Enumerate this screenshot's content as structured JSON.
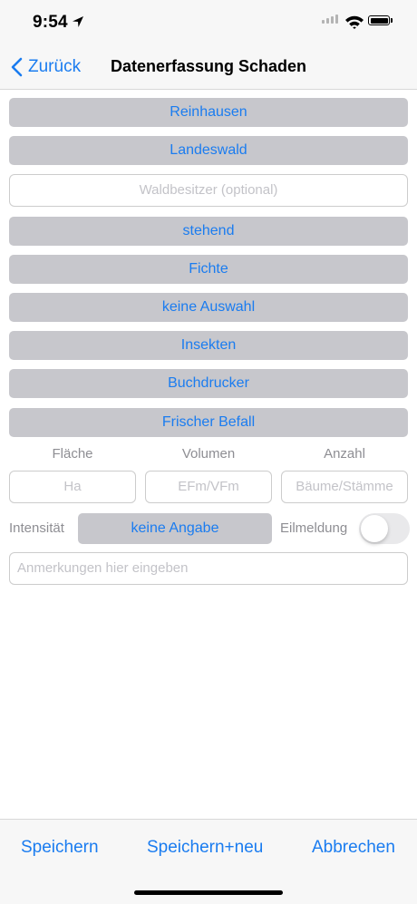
{
  "status_bar": {
    "time": "9:54"
  },
  "nav": {
    "back_label": "Zurück",
    "title": "Datenerfassung Schaden"
  },
  "form": {
    "ort": "Reinhausen",
    "waldart": "Landeswald",
    "waldbesitzer_placeholder": "Waldbesitzer (optional)",
    "zustand": "stehend",
    "baumart": "Fichte",
    "auswahl": "keine Auswahl",
    "ursache": "Insekten",
    "schaedling": "Buchdrucker",
    "befall": "Frischer Befall",
    "columns": {
      "flaeche": "Fläche",
      "volumen": "Volumen",
      "anzahl": "Anzahl"
    },
    "placeholders": {
      "flaeche": "Ha",
      "volumen": "EFm/VFm",
      "anzahl": "Bäume/Stämme"
    },
    "intensitaet_label": "Intensität",
    "intensitaet_value": "keine Angabe",
    "eilmeldung_label": "Eilmeldung",
    "eilmeldung_on": false,
    "anmerkungen_placeholder": "Anmerkungen hier eingeben"
  },
  "toolbar": {
    "save": "Speichern",
    "save_new": "Speichern+neu",
    "cancel": "Abbrechen"
  },
  "colors": {
    "accent": "#1a7cf0",
    "button_bg": "#c7c7cc",
    "bar_bg": "#f7f7f7"
  }
}
